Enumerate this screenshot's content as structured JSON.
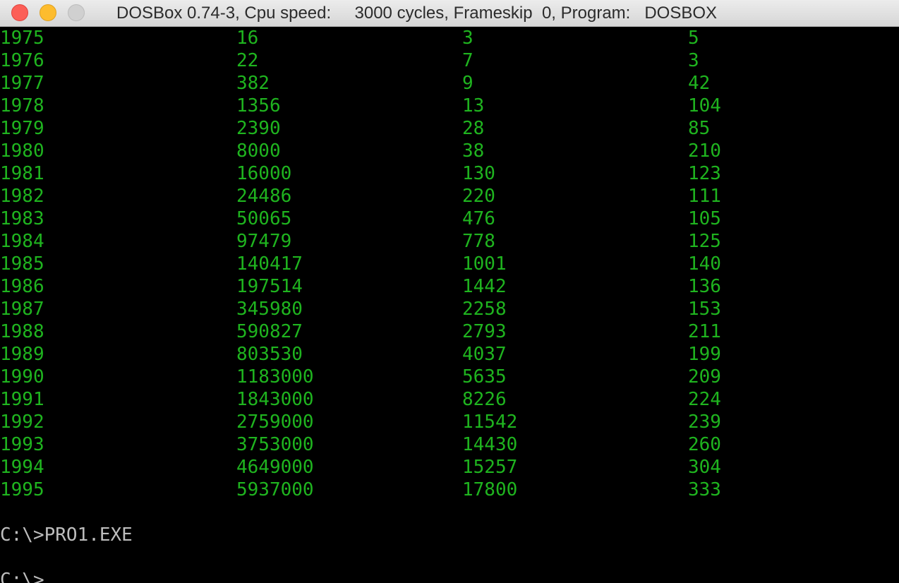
{
  "window": {
    "title": "DOSBox 0.74-3, Cpu speed:     3000 cycles, Frameskip  0, Program:   DOSBOX"
  },
  "output_rows": [
    [
      "1975",
      "16",
      "3",
      "5"
    ],
    [
      "1976",
      "22",
      "7",
      "3"
    ],
    [
      "1977",
      "382",
      "9",
      "42"
    ],
    [
      "1978",
      "1356",
      "13",
      "104"
    ],
    [
      "1979",
      "2390",
      "28",
      "85"
    ],
    [
      "1980",
      "8000",
      "38",
      "210"
    ],
    [
      "1981",
      "16000",
      "130",
      "123"
    ],
    [
      "1982",
      "24486",
      "220",
      "111"
    ],
    [
      "1983",
      "50065",
      "476",
      "105"
    ],
    [
      "1984",
      "97479",
      "778",
      "125"
    ],
    [
      "1985",
      "140417",
      "1001",
      "140"
    ],
    [
      "1986",
      "197514",
      "1442",
      "136"
    ],
    [
      "1987",
      "345980",
      "2258",
      "153"
    ],
    [
      "1988",
      "590827",
      "2793",
      "211"
    ],
    [
      "1989",
      "803530",
      "4037",
      "199"
    ],
    [
      "1990",
      "1183000",
      "5635",
      "209"
    ],
    [
      "1991",
      "1843000",
      "8226",
      "224"
    ],
    [
      "1992",
      "2759000",
      "11542",
      "239"
    ],
    [
      "1993",
      "3753000",
      "14430",
      "260"
    ],
    [
      "1994",
      "4649000",
      "15257",
      "304"
    ],
    [
      "1995",
      "5937000",
      "17800",
      "333"
    ]
  ],
  "prompt_lines": [
    "C:\\>PRO1.EXE",
    "C:\\>"
  ],
  "colors": {
    "output_text": "#1fb41f",
    "prompt_text": "#bdbdbd",
    "background": "#000000"
  }
}
